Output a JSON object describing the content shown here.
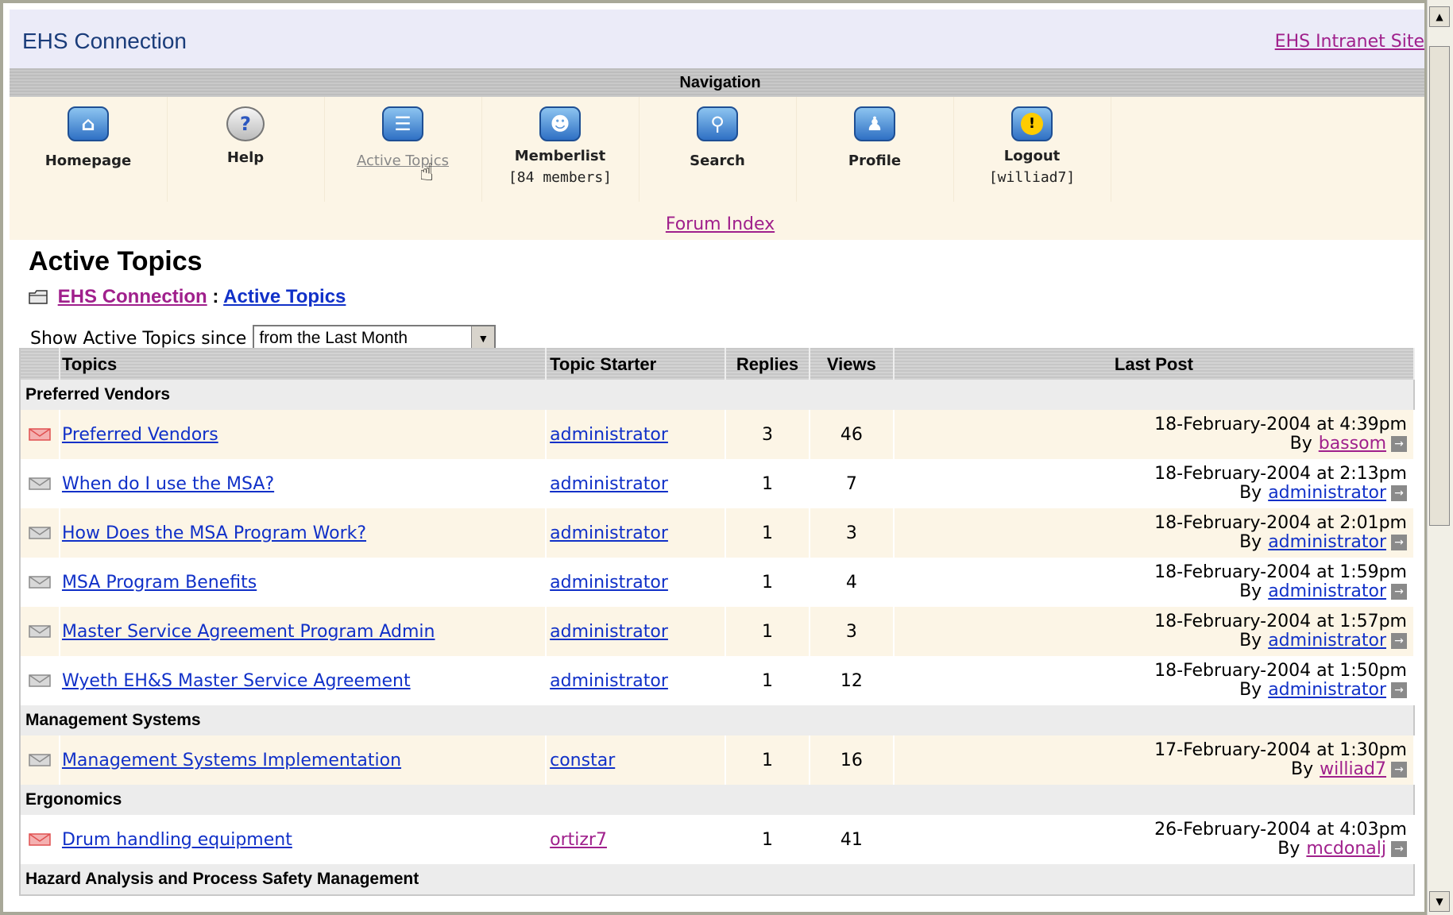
{
  "header": {
    "title": "EHS Connection",
    "intranet_link": "EHS Intranet Site"
  },
  "navigation": {
    "heading": "Navigation",
    "items": [
      {
        "label": "Homepage",
        "sub": "",
        "icon": "home-icon"
      },
      {
        "label": "Help",
        "sub": "",
        "icon": "help-icon"
      },
      {
        "label": "Active Topics",
        "sub": "",
        "icon": "active-topics-icon"
      },
      {
        "label": "Memberlist",
        "sub": "[84 members]",
        "icon": "memberlist-icon"
      },
      {
        "label": "Search",
        "sub": "",
        "icon": "search-icon"
      },
      {
        "label": "Profile",
        "sub": "",
        "icon": "profile-icon"
      },
      {
        "label": "Logout",
        "sub": "[williad7]",
        "icon": "logout-icon"
      }
    ],
    "forum_index": "Forum Index"
  },
  "page": {
    "title": "Active Topics",
    "breadcrumb": {
      "root": "EHS Connection",
      "sep": ":",
      "current": "Active Topics"
    },
    "filter_label": "Show Active Topics since",
    "filter_value": "from the Last Month"
  },
  "table": {
    "headers": [
      "Topics",
      "Topic Starter",
      "Replies",
      "Views",
      "Last Post"
    ],
    "categories": [
      {
        "name": "Preferred Vendors",
        "rows": [
          {
            "topic": "Preferred Vendors",
            "starter": "administrator",
            "replies": "3",
            "views": "46",
            "date": "18-February-2004 at 4:39pm",
            "by": "By",
            "last_user": "bassom",
            "new": true
          },
          {
            "topic": "When do I use the MSA?",
            "starter": "administrator",
            "replies": "1",
            "views": "7",
            "date": "18-February-2004 at 2:13pm",
            "by": "By",
            "last_user": "administrator",
            "new": false
          },
          {
            "topic": "How Does the MSA Program Work?",
            "starter": "administrator",
            "replies": "1",
            "views": "3",
            "date": "18-February-2004 at 2:01pm",
            "by": "By",
            "last_user": "administrator",
            "new": false
          },
          {
            "topic": "MSA Program Benefits",
            "starter": "administrator",
            "replies": "1",
            "views": "4",
            "date": "18-February-2004 at 1:59pm",
            "by": "By",
            "last_user": "administrator",
            "new": false
          },
          {
            "topic": "Master Service Agreement Program Admin",
            "starter": "administrator",
            "replies": "1",
            "views": "3",
            "date": "18-February-2004 at 1:57pm",
            "by": "By",
            "last_user": "administrator",
            "new": false
          },
          {
            "topic": "Wyeth EH&S Master Service Agreement",
            "starter": "administrator",
            "replies": "1",
            "views": "12",
            "date": "18-February-2004 at 1:50pm",
            "by": "By",
            "last_user": "administrator",
            "new": false
          }
        ]
      },
      {
        "name": "Management Systems",
        "rows": [
          {
            "topic": "Management Systems Implementation",
            "starter": "constar",
            "replies": "1",
            "views": "16",
            "date": "17-February-2004 at 1:30pm",
            "by": "By",
            "last_user": "williad7",
            "new": false
          }
        ]
      },
      {
        "name": "Ergonomics",
        "rows": [
          {
            "topic": "Drum handling equipment",
            "starter": "ortizr7",
            "replies": "1",
            "views": "41",
            "date": "26-February-2004 at 4:03pm",
            "by": "By",
            "last_user": "mcdonalj",
            "new": true
          }
        ]
      },
      {
        "name": "Hazard Analysis and Process Safety Management",
        "rows": []
      }
    ]
  },
  "colors": {
    "link": "#1030c8",
    "visited": "#a0208c",
    "header_bg": "#ebebf8",
    "nav_bg": "#fcf5e6"
  }
}
